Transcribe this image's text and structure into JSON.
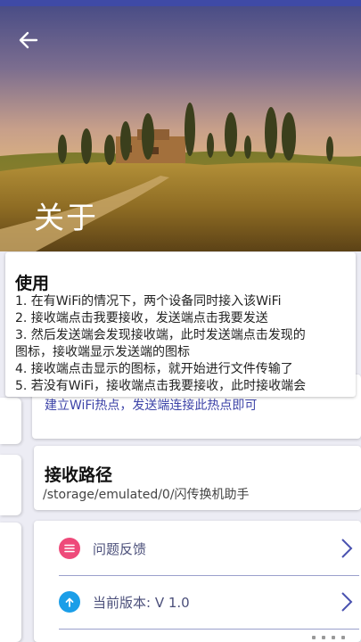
{
  "hero": {
    "title": "关于",
    "back_icon": "arrow-left-icon"
  },
  "usage": {
    "title": "使用",
    "lines": [
      "1. 在有WiFi的情况下，两个设备同时接入该WiFi",
      "2. 接收端点击我要接收，发送端点击我要发送",
      "3. 然后发送端会发现接收端，此时发送端点击发现的",
      "图标，接收端显示发送端的图标",
      "4. 接收端点击显示的图标，就开始进行文件传输了",
      "5. 若没有WiFi，接收端点击我要接收，此时接收端会"
    ],
    "overflow_line": "建立WiFi热点，发送端连接此热点即可"
  },
  "receive_path": {
    "title": "接收路径",
    "value": "/storage/emulated/0/闪传换机助手"
  },
  "menu": {
    "feedback": {
      "label": "问题反馈",
      "icon": "menu-lines-icon",
      "color": "#ee4a7a"
    },
    "version": {
      "label": "当前版本:   V 1.0",
      "icon": "upload-arrow-icon",
      "color": "#1b9ee8"
    }
  },
  "colors": {
    "accent": "#3f4aa6",
    "divider": "#9aa0cc"
  }
}
